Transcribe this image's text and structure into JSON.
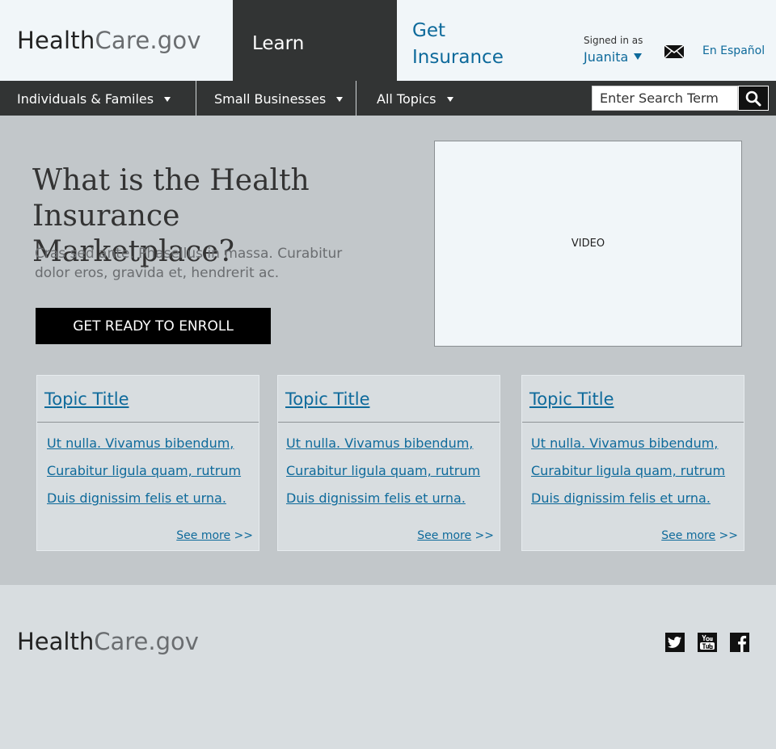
{
  "header": {
    "logo_health": "Health",
    "logo_care": "Care.gov",
    "learn_tab": "Learn",
    "get_insurance": "Get Insurance",
    "signed_in_as": "Signed in as",
    "user_name": "Juanita",
    "espanol": "En Español"
  },
  "nav": {
    "items": [
      {
        "label": "Individuals & Familes"
      },
      {
        "label": "Small Businesses"
      },
      {
        "label": "All Topics"
      }
    ],
    "search_placeholder": "Enter Search Term"
  },
  "hero": {
    "title": "What is the Health Insurance Marketplace?",
    "subtitle": "Cras sed ante. Phasellus in massa. Curabitur dolor eros, gravida et, hendrerit ac.",
    "cta": "GET READY TO ENROLL",
    "video_label": "VIDEO"
  },
  "cards": [
    {
      "title": "Topic Title",
      "links": [
        "Ut nulla. Vivamus bibendum,",
        "Curabitur ligula quam, rutrum",
        "Duis dignissim felis et urna."
      ],
      "see_more": "See more",
      "arrows": ">>"
    },
    {
      "title": "Topic Title",
      "links": [
        "Ut nulla. Vivamus bibendum,",
        "Curabitur ligula quam, rutrum",
        "Duis dignissim felis et urna."
      ],
      "see_more": "See more",
      "arrows": ">>"
    },
    {
      "title": "Topic Title",
      "links": [
        "Ut nulla. Vivamus bibendum,",
        "Curabitur ligula quam, rutrum",
        "Duis dignissim felis et urna."
      ],
      "see_more": "See more",
      "arrows": ">>"
    }
  ],
  "footer": {
    "logo_health": "Health",
    "logo_care": "Care.gov",
    "social_icons": [
      "twitter-icon",
      "youtube-icon",
      "facebook-icon"
    ]
  },
  "colors": {
    "link_blue": "#0e6a9b",
    "dark_bar": "#323434",
    "hero_bg": "#c2c7ca",
    "header_bg": "#f1f6f9"
  }
}
